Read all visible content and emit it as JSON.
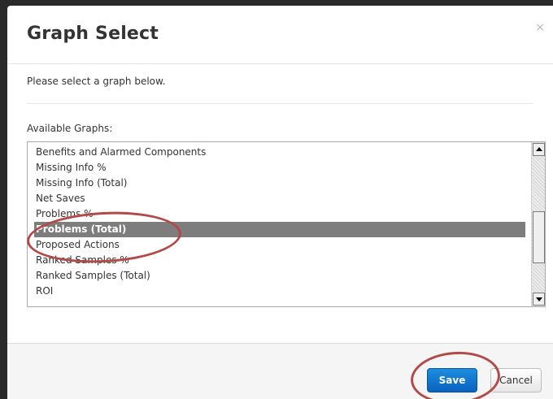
{
  "dialog": {
    "title": "Graph Select",
    "close_glyph": "×",
    "intro": "Please select a graph below.",
    "list_label": "Available Graphs:"
  },
  "graphs": {
    "options": [
      "Benefits and Alarmed Components",
      "Missing Info %",
      "Missing Info (Total)",
      "Net Saves",
      "Problems %",
      "Problems (Total)",
      "Proposed Actions",
      "Ranked Samples %",
      "Ranked Samples (Total)",
      "ROI"
    ],
    "selected": "Problems (Total)"
  },
  "footer": {
    "save_label": "Save",
    "cancel_label": "Cancel"
  },
  "icons": {
    "close": "close-icon",
    "scroll_up": "arrow-up-icon",
    "scroll_down": "arrow-down-icon"
  },
  "colors": {
    "selection": "#7d7d7d",
    "primary_button": "#0a62bf",
    "annotation": "#b24a48"
  }
}
